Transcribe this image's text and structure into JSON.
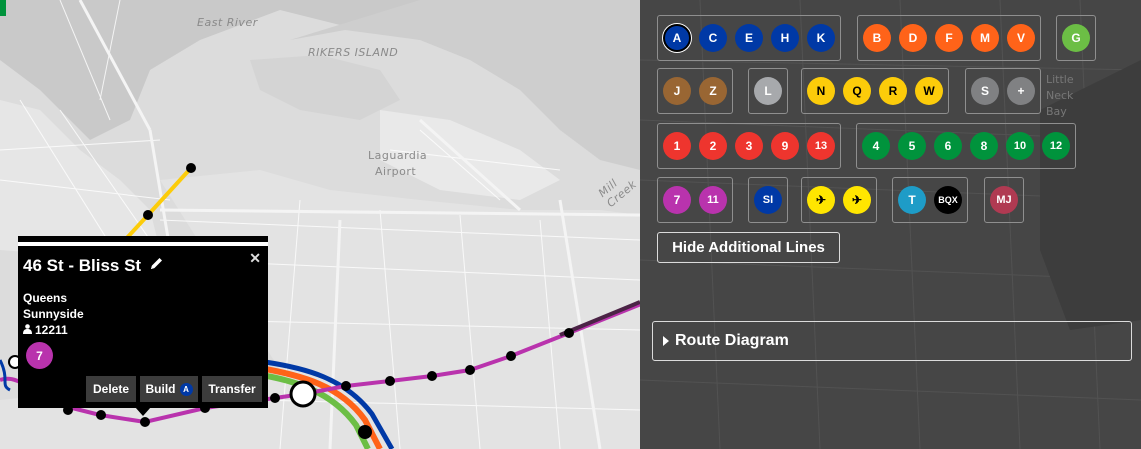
{
  "map": {
    "labels": {
      "east_river": "East River",
      "rikers_island": "RIKERS ISLAND",
      "laguardia_1": "Laguardia",
      "laguardia_2": "Airport",
      "mill_creek": "Mill Creek"
    }
  },
  "popup": {
    "station_name": "46 St - Bliss St",
    "borough": "Queens",
    "neighborhood": "Sunnyside",
    "ridership": "12211",
    "line": "7",
    "line_color": "#b933ad",
    "close_icon": "close-icon",
    "edit_icon": "pencil-icon",
    "person_icon": "person-icon",
    "buttons": {
      "delete": "Delete",
      "build": "Build",
      "build_line": "A",
      "transfer": "Transfer"
    }
  },
  "panel": {
    "groups": [
      {
        "lines": [
          {
            "label": "A",
            "bg": "#0039a6",
            "fg": "#ffffff",
            "selected": true
          },
          {
            "label": "C",
            "bg": "#0039a6",
            "fg": "#ffffff"
          },
          {
            "label": "E",
            "bg": "#0039a6",
            "fg": "#ffffff"
          },
          {
            "label": "H",
            "bg": "#0039a6",
            "fg": "#ffffff"
          },
          {
            "label": "K",
            "bg": "#0039a6",
            "fg": "#ffffff"
          }
        ]
      },
      {
        "lines": [
          {
            "label": "B",
            "bg": "#ff6319",
            "fg": "#ffffff"
          },
          {
            "label": "D",
            "bg": "#ff6319",
            "fg": "#ffffff"
          },
          {
            "label": "F",
            "bg": "#ff6319",
            "fg": "#ffffff"
          },
          {
            "label": "M",
            "bg": "#ff6319",
            "fg": "#ffffff"
          },
          {
            "label": "V",
            "bg": "#ff6319",
            "fg": "#ffffff"
          }
        ]
      },
      {
        "lines": [
          {
            "label": "G",
            "bg": "#6cbe45",
            "fg": "#ffffff"
          }
        ]
      },
      {
        "lines": [
          {
            "label": "J",
            "bg": "#996633",
            "fg": "#ffffff"
          },
          {
            "label": "Z",
            "bg": "#996633",
            "fg": "#ffffff"
          }
        ]
      },
      {
        "lines": [
          {
            "label": "L",
            "bg": "#a7a9ac",
            "fg": "#ffffff"
          }
        ]
      },
      {
        "lines": [
          {
            "label": "N",
            "bg": "#fccc0a",
            "fg": "#000000"
          },
          {
            "label": "Q",
            "bg": "#fccc0a",
            "fg": "#000000"
          },
          {
            "label": "R",
            "bg": "#fccc0a",
            "fg": "#000000"
          },
          {
            "label": "W",
            "bg": "#fccc0a",
            "fg": "#000000"
          }
        ]
      },
      {
        "lines": [
          {
            "label": "S",
            "bg": "#808183",
            "fg": "#ffffff"
          },
          {
            "label": "+",
            "bg": "#808183",
            "fg": "#ffffff"
          }
        ]
      },
      {
        "lines": [
          {
            "label": "1",
            "bg": "#ee352e",
            "fg": "#ffffff"
          },
          {
            "label": "2",
            "bg": "#ee352e",
            "fg": "#ffffff"
          },
          {
            "label": "3",
            "bg": "#ee352e",
            "fg": "#ffffff"
          },
          {
            "label": "9",
            "bg": "#ee352e",
            "fg": "#ffffff"
          },
          {
            "label": "13",
            "bg": "#ee352e",
            "fg": "#ffffff"
          }
        ]
      },
      {
        "lines": [
          {
            "label": "4",
            "bg": "#00933c",
            "fg": "#ffffff"
          },
          {
            "label": "5",
            "bg": "#00933c",
            "fg": "#ffffff"
          },
          {
            "label": "6",
            "bg": "#00933c",
            "fg": "#ffffff"
          },
          {
            "label": "8",
            "bg": "#00933c",
            "fg": "#ffffff"
          },
          {
            "label": "10",
            "bg": "#00933c",
            "fg": "#ffffff"
          },
          {
            "label": "12",
            "bg": "#00933c",
            "fg": "#ffffff"
          }
        ]
      },
      {
        "lines": [
          {
            "label": "7",
            "bg": "#b933ad",
            "fg": "#ffffff"
          },
          {
            "label": "11",
            "bg": "#b933ad",
            "fg": "#ffffff"
          }
        ]
      },
      {
        "lines": [
          {
            "label": "SI",
            "bg": "#0039a6",
            "fg": "#ffffff"
          }
        ]
      },
      {
        "lines": [
          {
            "label": "✈",
            "bg": "#ffe600",
            "fg": "#000000"
          },
          {
            "label": "✈",
            "bg": "#ffe600",
            "fg": "#000000"
          }
        ]
      },
      {
        "lines": [
          {
            "label": "T",
            "bg": "#1e9cc7",
            "fg": "#ffffff"
          },
          {
            "label": "BQX",
            "bg": "#000000",
            "fg": "#ffffff"
          }
        ]
      },
      {
        "lines": [
          {
            "label": "MJ",
            "bg": "#b03a52",
            "fg": "#ffffff"
          }
        ]
      }
    ],
    "hide_lines_label": "Hide Additional Lines",
    "route_diagram_label": "Route Diagram",
    "bg_labels": {
      "little": "Little",
      "neck": "Neck",
      "bay": "Bay"
    }
  }
}
